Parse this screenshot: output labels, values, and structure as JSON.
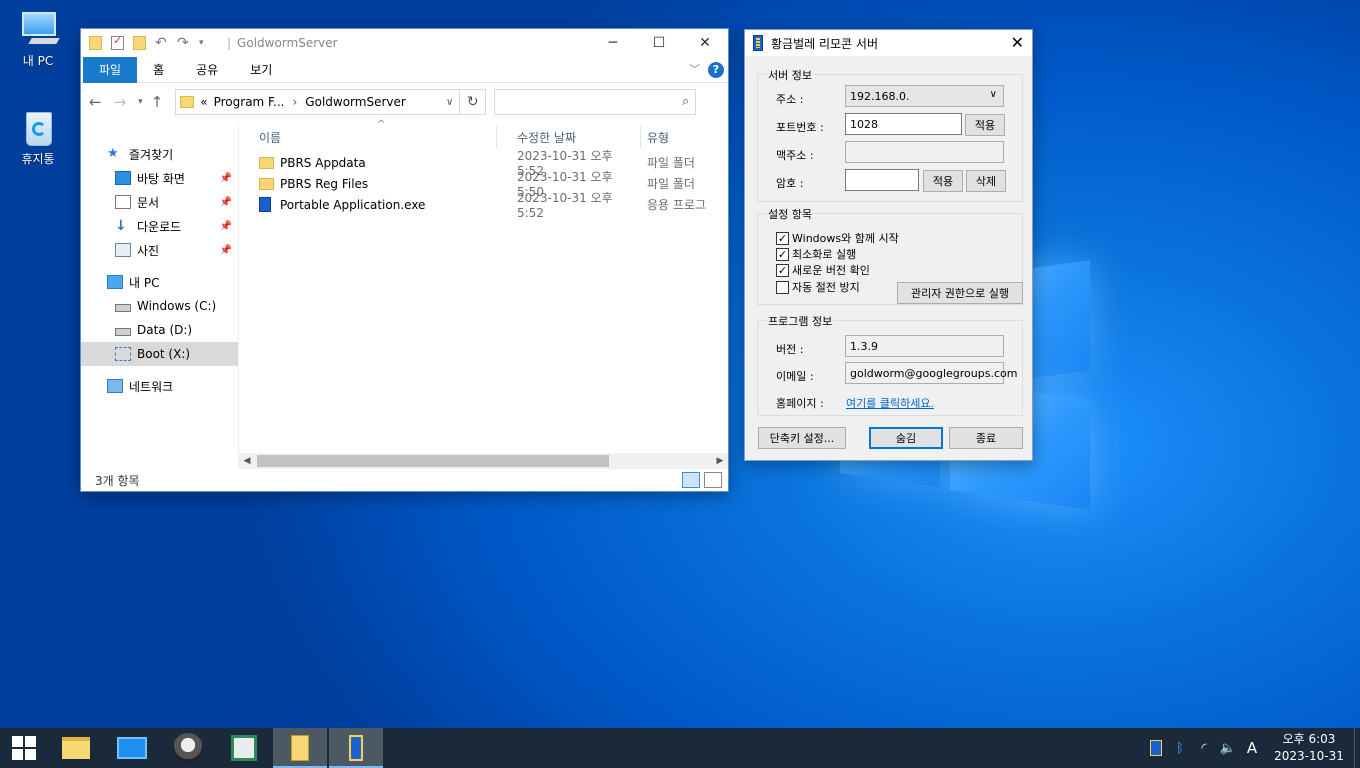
{
  "desktop": {
    "icons": [
      {
        "label": "내 PC"
      },
      {
        "label": "휴지통"
      }
    ]
  },
  "explorer": {
    "title": "GoldwormServer",
    "ribbon_tabs": [
      "파일",
      "홈",
      "공유",
      "보기"
    ],
    "address": {
      "prefix": "«",
      "parts": [
        "Program F...",
        "GoldwormServer"
      ]
    },
    "search_placeholder": "",
    "nav": {
      "quick_access": "즐겨찾기",
      "desktop": "바탕 화면",
      "documents": "문서",
      "downloads": "다운로드",
      "pictures": "사진",
      "this_pc": "내 PC",
      "drive_c": "Windows (C:)",
      "drive_d": "Data (D:)",
      "drive_x": "Boot (X:)",
      "network": "네트워크"
    },
    "columns": {
      "name": "이름",
      "date": "수정한 날짜",
      "type": "유형"
    },
    "files": [
      {
        "name": "PBRS Appdata",
        "date": "2023-10-31 오후 5:52",
        "type": "파일 폴더",
        "kind": "folder"
      },
      {
        "name": "PBRS Reg Files",
        "date": "2023-10-31 오후 5:50",
        "type": "파일 폴더",
        "kind": "folder"
      },
      {
        "name": "Portable Application.exe",
        "date": "2023-10-31 오후 5:52",
        "type": "응용 프로그",
        "kind": "exe"
      }
    ],
    "status": "3개 항목"
  },
  "dialog": {
    "title": "황금벌레 리모콘 서버",
    "server_group": "서버 정보",
    "address_label": "주소 :",
    "address_value": "192.168.0.",
    "port_label": "포트번호 :",
    "port_value": "1028",
    "apply_label": "적용",
    "mac_label": "맥주소 :",
    "mac_value": "",
    "password_label": "암호 :",
    "password_value": "",
    "delete_label": "삭제",
    "settings_group": "설정 항목",
    "options": [
      {
        "label": "Windows와 함께 시작",
        "checked": true
      },
      {
        "label": "최소화로 실행",
        "checked": true
      },
      {
        "label": "새로운 버전 확인",
        "checked": true
      },
      {
        "label": "자동 절전 방지",
        "checked": false
      }
    ],
    "run_admin": "관리자 권한으로 실행",
    "program_group": "프로그램 정보",
    "version_label": "버전 :",
    "version_value": "1.3.9",
    "email_label": "이메일 :",
    "email_value": "goldworm@googlegroups.com",
    "homepage_label": "홈페이지 :",
    "homepage_link": "여기를 클릭하세요.",
    "shortcut_button": "단축키 설정...",
    "hide_button": "숨김",
    "exit_button": "종료"
  },
  "taskbar": {
    "clock_time": "오후 6:03",
    "clock_date": "2023-10-31",
    "ime": "A"
  }
}
